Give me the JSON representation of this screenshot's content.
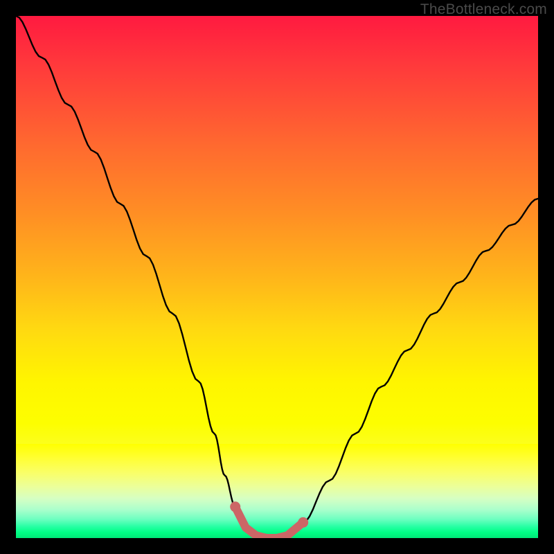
{
  "attribution": "TheBottleneck.com",
  "colors": {
    "background_frame": "#000000",
    "curve": "#000000",
    "highlight": "#cc6666"
  },
  "chart_data": {
    "type": "line",
    "title": "",
    "xlabel": "",
    "ylabel": "",
    "xlim": [
      0,
      100
    ],
    "ylim": [
      0,
      100
    ],
    "annotations": [],
    "series": [
      {
        "name": "bottleneck-curve",
        "x": [
          0,
          5,
          10,
          15,
          20,
          25,
          30,
          35,
          38,
          40,
          42,
          44,
          46,
          48,
          50,
          52,
          55,
          60,
          65,
          70,
          75,
          80,
          85,
          90,
          95,
          100
        ],
        "values": [
          100,
          92,
          83,
          74,
          64,
          54,
          43,
          30,
          20,
          12,
          6,
          2,
          0.5,
          0,
          0,
          0.5,
          3,
          11,
          20,
          29,
          36,
          43,
          49,
          55,
          60,
          65
        ]
      },
      {
        "name": "optimal-range-highlight",
        "x": [
          42,
          44,
          46,
          48,
          50,
          52,
          55
        ],
        "values": [
          6,
          2,
          0.5,
          0,
          0,
          0.5,
          3
        ]
      }
    ]
  }
}
